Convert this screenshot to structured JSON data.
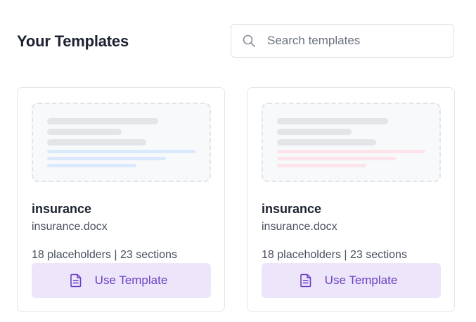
{
  "header": {
    "title": "Your Templates"
  },
  "search": {
    "placeholder": "Search templates",
    "icon": "search-icon"
  },
  "templates": [
    {
      "name": "insurance",
      "file": "insurance.docx",
      "meta": "18 placeholders | 23 sections",
      "button_label": "Use Template",
      "accent_color": "#dbe9fc"
    },
    {
      "name": "insurance",
      "file": "insurance.docx",
      "meta": "18 placeholders | 23 sections",
      "button_label": "Use Template",
      "accent_color": "#fde3ea"
    }
  ],
  "colors": {
    "button_bg": "#ede6fa",
    "button_text": "#6b3fc4"
  }
}
